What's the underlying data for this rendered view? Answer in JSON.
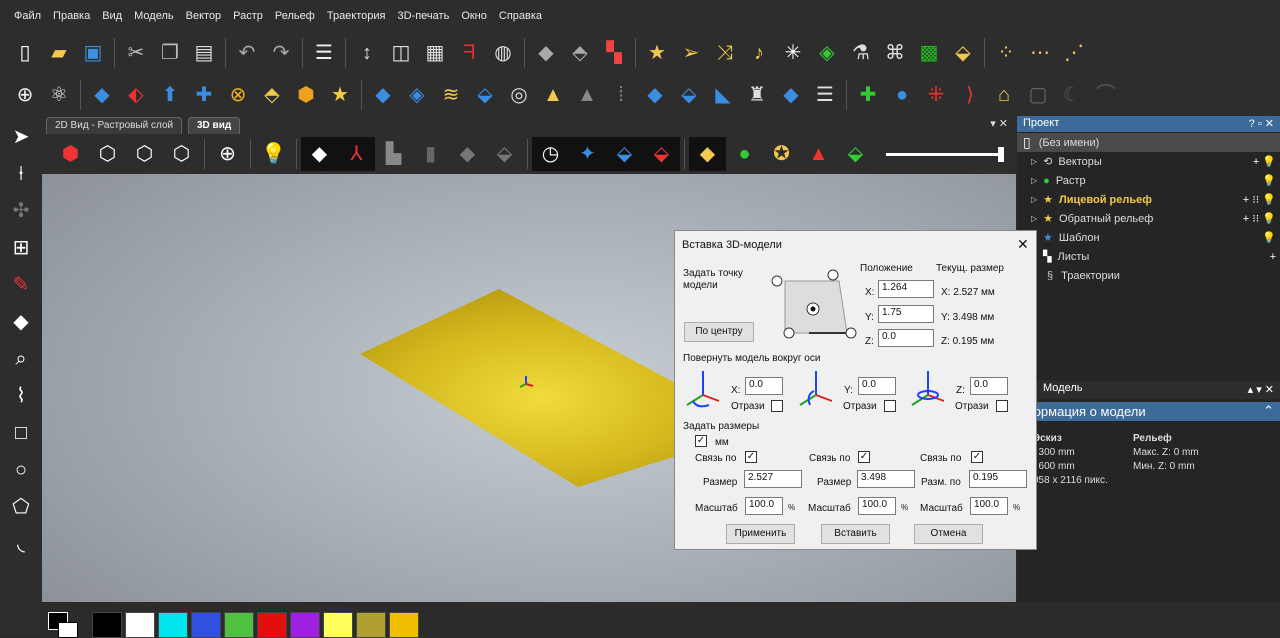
{
  "menu": [
    "Файл",
    "Правка",
    "Вид",
    "Модель",
    "Вектор",
    "Растр",
    "Рельеф",
    "Траектория",
    "3D-печать",
    "Окно",
    "Справка"
  ],
  "tabs": {
    "tab1": "2D Вид - Растровый слой",
    "tab2": "3D вид",
    "controls": "▾ ✕"
  },
  "project": {
    "title": "Проект",
    "controls": "? ▫ ✕",
    "root": "(Без имени)",
    "items": [
      {
        "label": "Векторы",
        "icon": "vectors-icon",
        "actions": "+ 💡"
      },
      {
        "label": "Растр",
        "icon": "raster-icon",
        "actions": "💡"
      },
      {
        "label": "Лицевой рельеф",
        "icon": "star-icon",
        "actions": "+ ⁝⁝ 💡"
      },
      {
        "label": "Обратный рельеф",
        "icon": "star-icon",
        "actions": "+ ⁝⁝ 💡"
      },
      {
        "label": "Шаблон",
        "icon": "template-icon",
        "actions": "💡"
      },
      {
        "label": "Листы",
        "icon": "sheets-icon",
        "actions": "+"
      },
      {
        "label": "Траектории",
        "icon": "toolpath-icon",
        "actions": ""
      }
    ]
  },
  "model": {
    "title": "Модель",
    "controls": "▴ ▾ ✕",
    "info_title": "формация о модели",
    "sketch_h": "Эскиз",
    "sketch_x": ": 300 mm",
    "sketch_y": ": 600 mm",
    "sketch_px": "058 x 2116 пикс.",
    "relief_h": "Рельеф",
    "relief_max": "Макс. Z: 0 mm",
    "relief_min": "Мин. Z: 0 mm"
  },
  "dialog": {
    "title": "Вставка 3D-модели",
    "close": "✕",
    "set_point": "Задать точку модели",
    "center_btn": "По центру",
    "pos_h": "Положение",
    "size_h": "Текущ. размер",
    "pos": {
      "x_label": "X:",
      "x": "1.264",
      "y_label": "Y:",
      "y": "1.75",
      "z_label": "Z:",
      "z": "0.0"
    },
    "cur": {
      "x": "X: 2.527 мм",
      "y": "Y: 3.498 мм",
      "z": "Z: 0.195 мм"
    },
    "rotate": "Повернуть модель вокруг оси",
    "rot": [
      {
        "label": "X:",
        "value": "0.0",
        "mirror": "Отрази"
      },
      {
        "label": "Y:",
        "value": "0.0",
        "mirror": "Отрази"
      },
      {
        "label": "Z:",
        "value": "0.0",
        "mirror": "Отрази"
      }
    ],
    "set_size": "Задать размеры",
    "mm": "мм",
    "link": "Связь по",
    "size": [
      {
        "label": "Размер",
        "value": "2.527"
      },
      {
        "label": "Размер",
        "value": "3.498"
      },
      {
        "label": "Разм. по",
        "value": "0.195"
      }
    ],
    "scale_label": "Масштаб",
    "scale": [
      "100.0",
      "100.0",
      "100.0"
    ],
    "pct": "%",
    "apply": "Применить",
    "insert": "Вставить",
    "cancel": "Отмена"
  },
  "palette": [
    "#000000",
    "#ffffff",
    "#00e5ee",
    "#3050e0",
    "#50c040",
    "#e01010",
    "#a020e0",
    "#ffff60",
    "#b0a030",
    "#f0c000"
  ],
  "colors": {
    "plane": "#d4b81e",
    "accent": "#3d6b99"
  }
}
